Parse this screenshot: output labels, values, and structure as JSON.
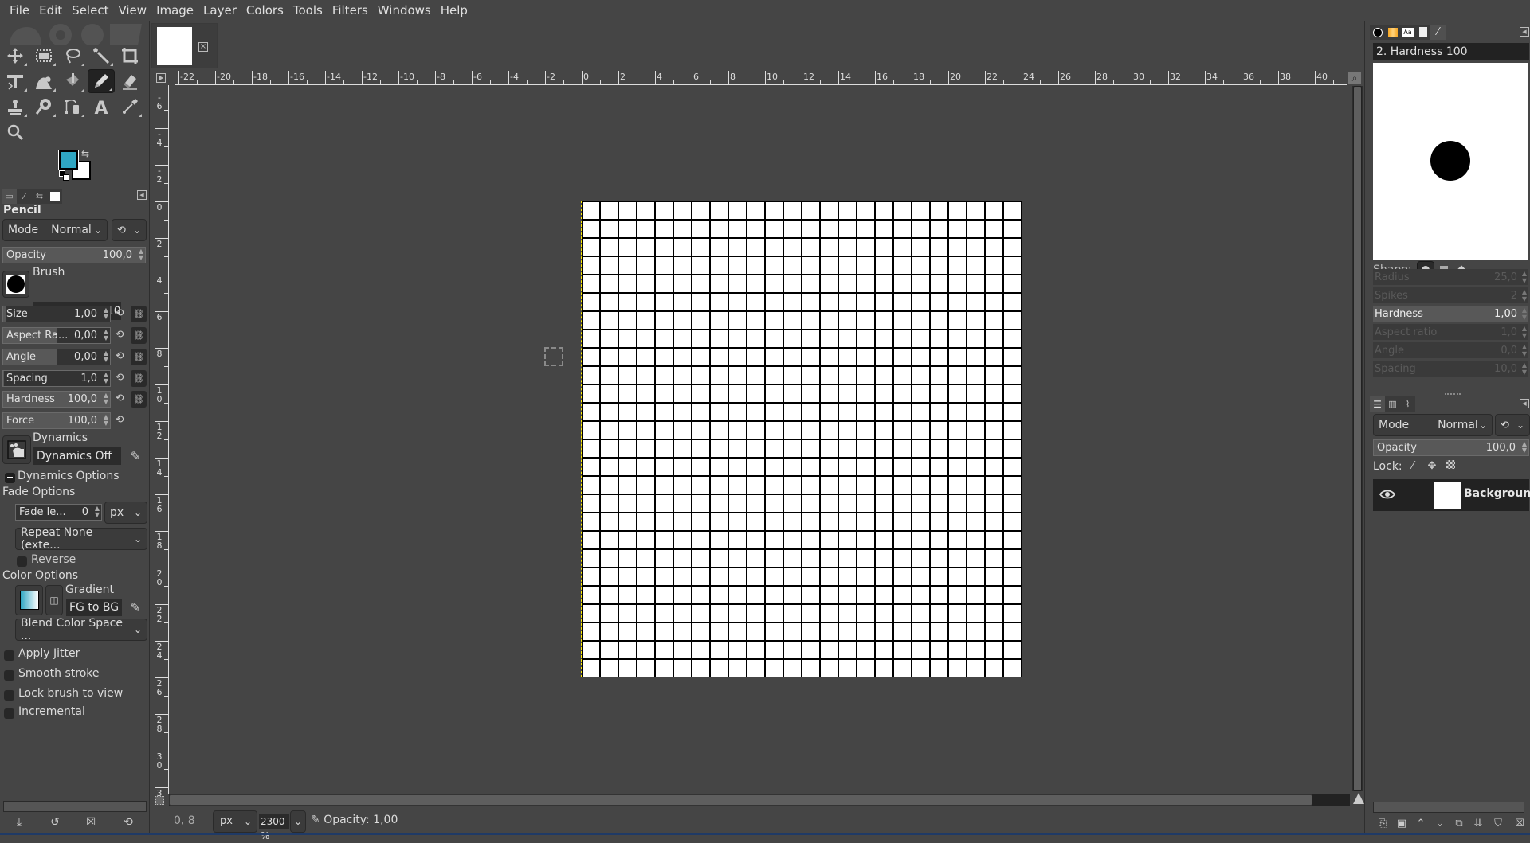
{
  "menubar": {
    "items": [
      "File",
      "Edit",
      "Select",
      "View",
      "Image",
      "Layer",
      "Colors",
      "Tools",
      "Filters",
      "Windows",
      "Help"
    ]
  },
  "toolbox": {
    "tools": [
      {
        "name": "move-tool",
        "active": false
      },
      {
        "name": "rect-select-tool",
        "active": false
      },
      {
        "name": "free-select-tool",
        "active": false
      },
      {
        "name": "fuzzy-select-tool",
        "active": false
      },
      {
        "name": "crop-tool",
        "active": false
      },
      {
        "name": "transform-tool",
        "active": false
      },
      {
        "name": "warp-tool",
        "active": false
      },
      {
        "name": "bucket-fill-tool",
        "active": false
      },
      {
        "name": "pencil-tool",
        "active": true
      },
      {
        "name": "eraser-tool",
        "active": false
      },
      {
        "name": "clone-tool",
        "active": false
      },
      {
        "name": "smudge-tool",
        "active": false
      },
      {
        "name": "paths-tool",
        "active": false
      },
      {
        "name": "text-tool",
        "active": false
      },
      {
        "name": "color-picker-tool",
        "active": false
      },
      {
        "name": "zoom-tool",
        "active": false
      }
    ],
    "foreground_color": "#2fa6c2",
    "background_color": "#ffffff"
  },
  "tool_options": {
    "title": "Pencil",
    "mode_label": "Mode",
    "mode_value": "Normal",
    "opacity": {
      "label": "Opacity",
      "value": "100,0"
    },
    "brush": {
      "label": "Brush",
      "value": "2. Hardness 100"
    },
    "sliders": [
      {
        "label": "Size",
        "value": "1,00",
        "fill": 0.02
      },
      {
        "label": "Aspect Ra...",
        "value": "0,00",
        "fill": 0.5
      },
      {
        "label": "Angle",
        "value": "0,00",
        "fill": 0.5
      },
      {
        "label": "Spacing",
        "value": "1,0",
        "fill": 0.01
      },
      {
        "label": "Hardness",
        "value": "100,0",
        "fill": 1.0
      },
      {
        "label": "Force",
        "value": "100,0",
        "fill": 1.0
      }
    ],
    "dynamics": {
      "label": "Dynamics",
      "value": "Dynamics Off"
    },
    "dynamics_options_label": "Dynamics Options",
    "fade_options_label": "Fade Options",
    "fade_length": {
      "label": "Fade le...",
      "value": "0",
      "unit": "px"
    },
    "repeat": "Repeat None (exte...",
    "reverse_label": "Reverse",
    "color_options_label": "Color Options",
    "gradient": {
      "label": "Gradient",
      "value": "FG to BG (R"
    },
    "blend_color_space": "Blend Color Space ...",
    "checkboxes": [
      {
        "label": "Apply Jitter",
        "checked": false
      },
      {
        "label": "Smooth stroke",
        "checked": false
      },
      {
        "label": "Lock brush to view",
        "checked": false
      },
      {
        "label": "Incremental",
        "checked": false
      }
    ]
  },
  "image_window": {
    "h_ruler_labels": [
      "-22",
      "-20",
      "-18",
      "-16",
      "-14",
      "-12",
      "-10",
      "-8",
      "-6",
      "-4",
      "-2",
      "0",
      "2",
      "4",
      "6",
      "8",
      "10",
      "12",
      "14",
      "16",
      "18",
      "20",
      "22",
      "24",
      "26",
      "28",
      "30",
      "32",
      "34",
      "36",
      "38",
      "40"
    ],
    "v_ruler_labels": [
      "-6",
      "-4",
      "-2",
      "0",
      "2",
      "4",
      "6",
      "8",
      "10",
      "12",
      "14",
      "16",
      "18",
      "20",
      "22",
      "24",
      "26",
      "28",
      "30",
      "3"
    ],
    "image_grid": {
      "columns": 24,
      "rows": 26
    }
  },
  "statusbar": {
    "coords": "0, 8",
    "unit": "px",
    "zoom": "2300 %",
    "message": "Opacity: 1,00"
  },
  "brushes_panel": {
    "selected_brush": "2. Hardness 100",
    "shape_label": "Shape:",
    "params": [
      {
        "label": "Radius",
        "value": "25,0",
        "enabled": false
      },
      {
        "label": "Spikes",
        "value": "2",
        "enabled": false
      },
      {
        "label": "Hardness",
        "value": "1,00",
        "enabled": true
      },
      {
        "label": "Aspect ratio",
        "value": "1,0",
        "enabled": false
      },
      {
        "label": "Angle",
        "value": "0,0",
        "enabled": false
      },
      {
        "label": "Spacing",
        "value": "10,0",
        "enabled": false
      }
    ]
  },
  "layers_panel": {
    "mode_label": "Mode",
    "mode_value": "Normal",
    "opacity": {
      "label": "Opacity",
      "value": "100,0"
    },
    "lock_label": "Lock:",
    "layers": [
      {
        "name": "Background",
        "visible": true
      }
    ]
  }
}
